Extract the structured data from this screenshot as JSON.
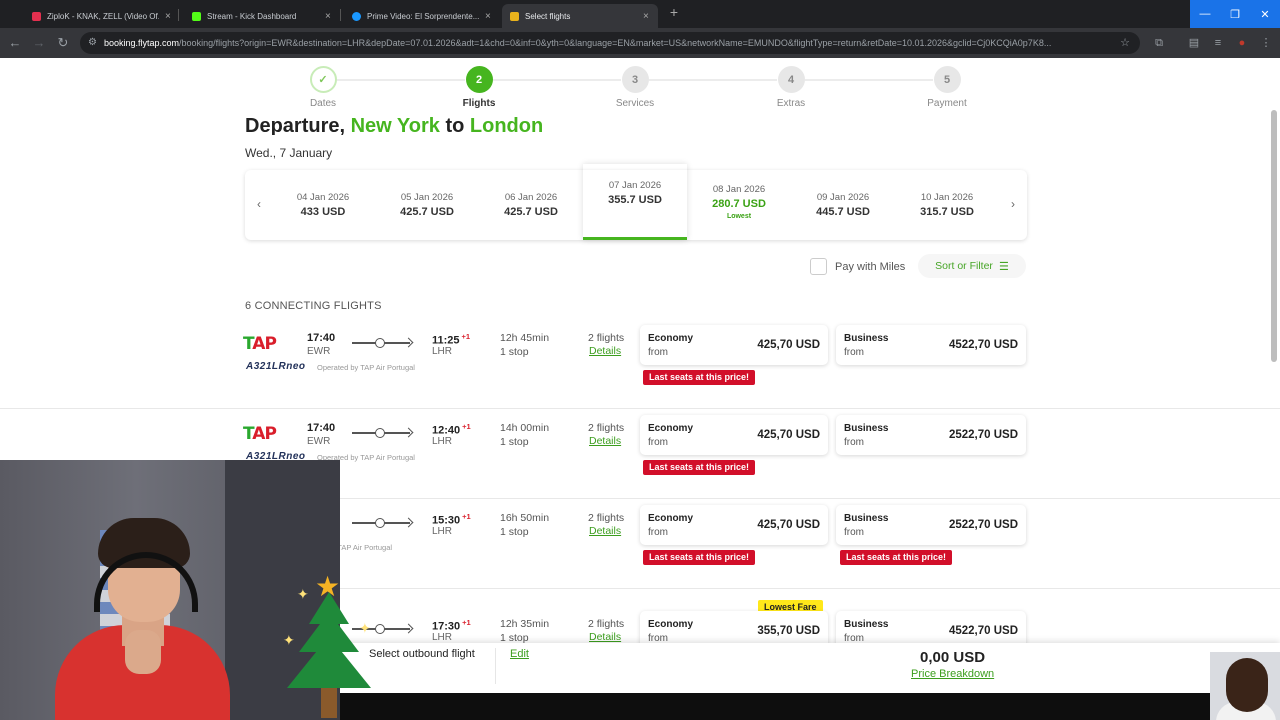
{
  "browser": {
    "tabs": [
      {
        "label": "ZiploK - KNAK, ZELL (Video Of...",
        "color": "#e3304f",
        "active": false
      },
      {
        "label": "Stream - Kick Dashboard",
        "color": "#53fc18",
        "active": false
      },
      {
        "label": "Prime Video: El Sorprendente...",
        "color": "#1a98ff",
        "active": false
      },
      {
        "label": "Select flights",
        "color": "#e9b21c",
        "active": true
      }
    ],
    "new_tab": "+",
    "url_domain": "booking.flytap.com",
    "url_path": "/booking/flights?origin=EWR&destination=LHR&depDate=07.01.2026&adt=1&chd=0&inf=0&yth=0&language=EN&market=US&networkName=EMUNDO&flightType=return&retDate=10.01.2026&gclid=Cj0KCQiA0p7K8..."
  },
  "stepper": {
    "steps": [
      {
        "num": "✓",
        "label": "Dates",
        "state": "done"
      },
      {
        "num": "2",
        "label": "Flights",
        "state": "current"
      },
      {
        "num": "3",
        "label": "Services",
        "state": "todo"
      },
      {
        "num": "4",
        "label": "Extras",
        "state": "todo"
      },
      {
        "num": "5",
        "label": "Payment",
        "state": "todo"
      }
    ]
  },
  "heading": {
    "prefix": "Departure, ",
    "origin": "New York",
    "mid": " to ",
    "destination": "London"
  },
  "subheading": "Wed., 7 January",
  "dates": [
    {
      "date": "04 Jan 2026",
      "price": "433 USD"
    },
    {
      "date": "05 Jan 2026",
      "price": "425.7 USD"
    },
    {
      "date": "06 Jan 2026",
      "price": "425.7 USD"
    },
    {
      "date": "07 Jan 2026",
      "price": "355.7 USD",
      "selected": true
    },
    {
      "date": "08 Jan 2026",
      "price": "280.7 USD",
      "tag": "Lowest"
    },
    {
      "date": "09 Jan 2026",
      "price": "445.7 USD"
    },
    {
      "date": "10 Jan 2026",
      "price": "315.7 USD"
    }
  ],
  "filters": {
    "pay_with_miles": "Pay with Miles",
    "sort_filter": "Sort or Filter"
  },
  "results_count": "6 CONNECTING FLIGHTS",
  "flights": [
    {
      "dep": "17:40",
      "dep_code": "EWR",
      "arr": "11:25",
      "plus": "+1",
      "arr_code": "LHR",
      "duration": "12h 45min",
      "stops": "1 stop",
      "nflights": "2 flights",
      "details": "Details",
      "aircraft": "A321LRneo",
      "operated": "Operated by TAP Air Portugal",
      "eco_label": "Economy",
      "eco_from": "from",
      "eco_price": "425,70 USD",
      "bus_label": "Business",
      "bus_from": "from",
      "bus_price": "4522,70 USD",
      "eco_tag": "Last seats at this price!",
      "bus_tag": ""
    },
    {
      "dep": "17:40",
      "dep_code": "EWR",
      "arr": "12:40",
      "plus": "+1",
      "arr_code": "LHR",
      "duration": "14h 00min",
      "stops": "1 stop",
      "nflights": "2 flights",
      "details": "Details",
      "aircraft": "A321LRneo",
      "operated": "Operated by TAP Air Portugal",
      "eco_label": "Economy",
      "eco_from": "from",
      "eco_price": "425,70 USD",
      "bus_label": "Business",
      "bus_from": "from",
      "bus_price": "2522,70 USD",
      "eco_tag": "Last seats at this price!",
      "bus_tag": ""
    },
    {
      "dep": "",
      "dep_code": "",
      "arr": "15:30",
      "plus": "+1",
      "arr_code": "LHR",
      "duration": "16h 50min",
      "stops": "1 stop",
      "nflights": "2 flights",
      "details": "Details",
      "aircraft": "",
      "operated": "ed by TAP Air Portugal",
      "eco_label": "Economy",
      "eco_from": "from",
      "eco_price": "425,70 USD",
      "bus_label": "Business",
      "bus_from": "from",
      "bus_price": "2522,70 USD",
      "eco_tag": "Last seats at this price!",
      "bus_tag": "Last seats at this price!"
    },
    {
      "dep": "",
      "dep_code": "",
      "arr": "17:30",
      "plus": "+1",
      "arr_code": "LHR",
      "duration": "12h 35min",
      "stops": "1 stop",
      "nflights": "2 flights",
      "details": "Details",
      "aircraft": "",
      "operated": "",
      "eco_label": "Economy",
      "eco_from": "from",
      "eco_price": "355,70 USD",
      "bus_label": "Business",
      "bus_from": "from",
      "bus_price": "4522,70 USD",
      "eco_tag": "",
      "bus_tag": "",
      "top_tag": "Lowest Fare"
    }
  ],
  "footer": {
    "select_outbound": "Select outbound flight",
    "edit": "Edit",
    "total": "0,00 USD",
    "price_breakdown": "Price Breakdown"
  },
  "colors": {
    "brand_green": "#46b51f",
    "alert_red": "#d20f2a",
    "lowest_yellow": "#ffe81a"
  }
}
